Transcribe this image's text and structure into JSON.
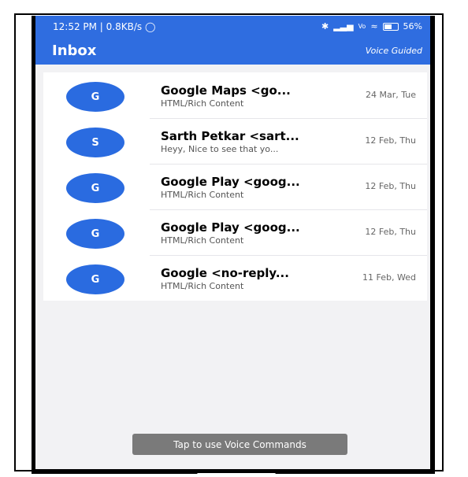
{
  "status": {
    "time": "12:52 PM | 0.8KB/s",
    "alarm_icon": "alarm-icon",
    "right_text": "56%",
    "icons": [
      "bluetooth-icon",
      "signal-icon",
      "vowifi-icon",
      "wifi-icon",
      "battery-icon"
    ]
  },
  "appbar": {
    "title": "Inbox",
    "voice_guided": "Voice Guided"
  },
  "emails": [
    {
      "avatar": "G",
      "sender": "Google Maps <go...",
      "preview": "HTML/Rich Content",
      "date": "24 Mar, Tue"
    },
    {
      "avatar": "S",
      "sender": "Sarth Petkar <sart...",
      "preview": "Heyy,  Nice to see that yo...",
      "date": "12 Feb, Thu"
    },
    {
      "avatar": "G",
      "sender": "Google Play <goog...",
      "preview": "HTML/Rich Content",
      "date": "12 Feb, Thu"
    },
    {
      "avatar": "G",
      "sender": "Google Play <goog...",
      "preview": "HTML/Rich Content",
      "date": "12 Feb, Thu"
    },
    {
      "avatar": "G",
      "sender": "Google <no-reply...",
      "preview": "HTML/Rich Content",
      "date": "11 Feb, Wed"
    }
  ],
  "voice_button": "Tap to use Voice Commands",
  "colors": {
    "primary": "#2f6de0",
    "avatar": "#2a6be0",
    "button": "#7a7a7a"
  }
}
